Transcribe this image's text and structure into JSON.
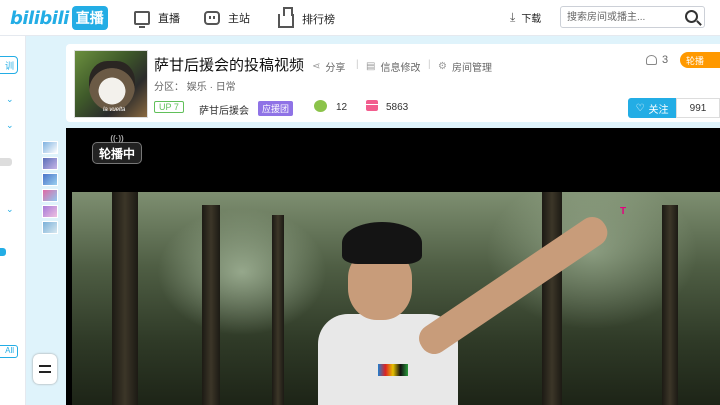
{
  "nav": {
    "logo_text": "bilibili",
    "logo_badge": "直播",
    "items": [
      {
        "label": "直播",
        "icon": "tv-icon"
      },
      {
        "label": "主站",
        "icon": "bilibili-icon"
      },
      {
        "label": "排行榜",
        "icon": "rank-icon"
      }
    ],
    "download_label": "下载",
    "search_placeholder": "搜索房间或播主..."
  },
  "sidebar": {
    "pill_label": "训",
    "all_label": "All"
  },
  "room": {
    "title": "萨甘后援会的投稿视频",
    "actions": {
      "share": "分享",
      "info_edit": "信息修改",
      "room_manage": "房间管理"
    },
    "area_prefix": "分区：",
    "area_parent": "娱乐",
    "area_sep": "·",
    "area_child": "日常",
    "level_badge": "UP 7",
    "anchor_name": "萨甘后援会",
    "fan_badge": "应援团",
    "gift_count": "12",
    "box_count": "5863",
    "viewer_count": "3",
    "lottery_label": "轮播",
    "follow_label": "关注",
    "follow_count": "991"
  },
  "player": {
    "carousel_label": "轮播中",
    "watermark": "T"
  },
  "colors": {
    "brand": "#23ade5",
    "lottery": "#ff9900",
    "level": "#61c05a",
    "fan_badge": "#8f73e6"
  }
}
